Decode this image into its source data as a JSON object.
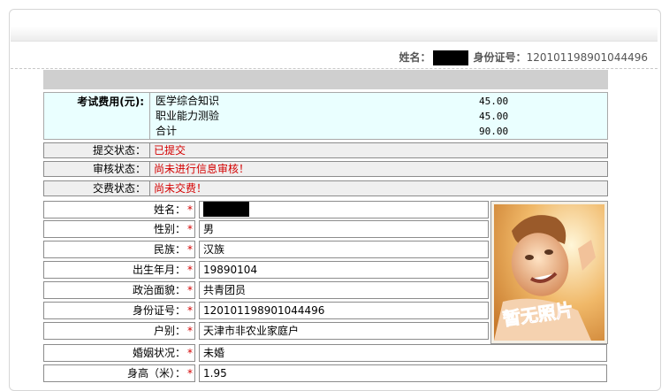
{
  "header": {
    "name_label": "姓名：",
    "id_label": "身份证号：",
    "id_value": "120101198901044496"
  },
  "fee": {
    "label": "考试费用(元):",
    "items": [
      {
        "name": "医学综合知识",
        "amount": "45.00"
      },
      {
        "name": "职业能力测验",
        "amount": "45.00"
      },
      {
        "name": "合计",
        "amount": "90.00"
      }
    ]
  },
  "status": [
    {
      "label": "提交状态：",
      "value": "已提交"
    },
    {
      "label": "审核状态：",
      "value": "尚未进行信息审核！"
    },
    {
      "label": "交费状态：",
      "value": "尚未交费！"
    }
  ],
  "form": {
    "star": "*",
    "fields": [
      {
        "label": "姓名：",
        "value": ""
      },
      {
        "label": "性别：",
        "value": "男"
      },
      {
        "label": "民族：",
        "value": "汉族"
      },
      {
        "label": "出生年月：",
        "value": "19890104"
      },
      {
        "label": "政治面貌：",
        "value": "共青团员"
      },
      {
        "label": "身份证号：",
        "value": "120101198901044496"
      },
      {
        "label": "户别：",
        "value": "天津市非农业家庭户"
      },
      {
        "label": "婚姻状况：",
        "value": "未婚"
      },
      {
        "label": "身高（米）：",
        "value": "1.95"
      }
    ]
  },
  "photo": {
    "caption": "暂无照片"
  }
}
